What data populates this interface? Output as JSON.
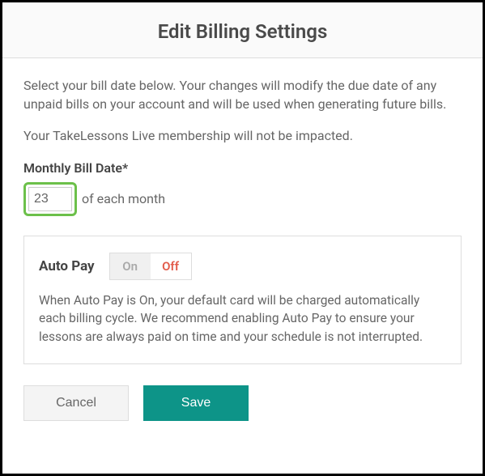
{
  "header": {
    "title": "Edit Billing Settings"
  },
  "intro": "Select your bill date below. Your changes will modify the due date of any unpaid bills on your account and will be used when generating future bills.",
  "membership_note": "Your TakeLessons Live membership will not be impacted.",
  "bill_date": {
    "label": "Monthly Bill Date*",
    "value": "23",
    "suffix": "of each month"
  },
  "autopay": {
    "title": "Auto Pay",
    "on_label": "On",
    "off_label": "Off",
    "selected": "off",
    "description": "When Auto Pay is On, your default card will be charged automatically each billing cycle. We recommend enabling Auto Pay to ensure your lessons are always paid on time and your schedule is not interrupted."
  },
  "actions": {
    "cancel": "Cancel",
    "save": "Save"
  }
}
